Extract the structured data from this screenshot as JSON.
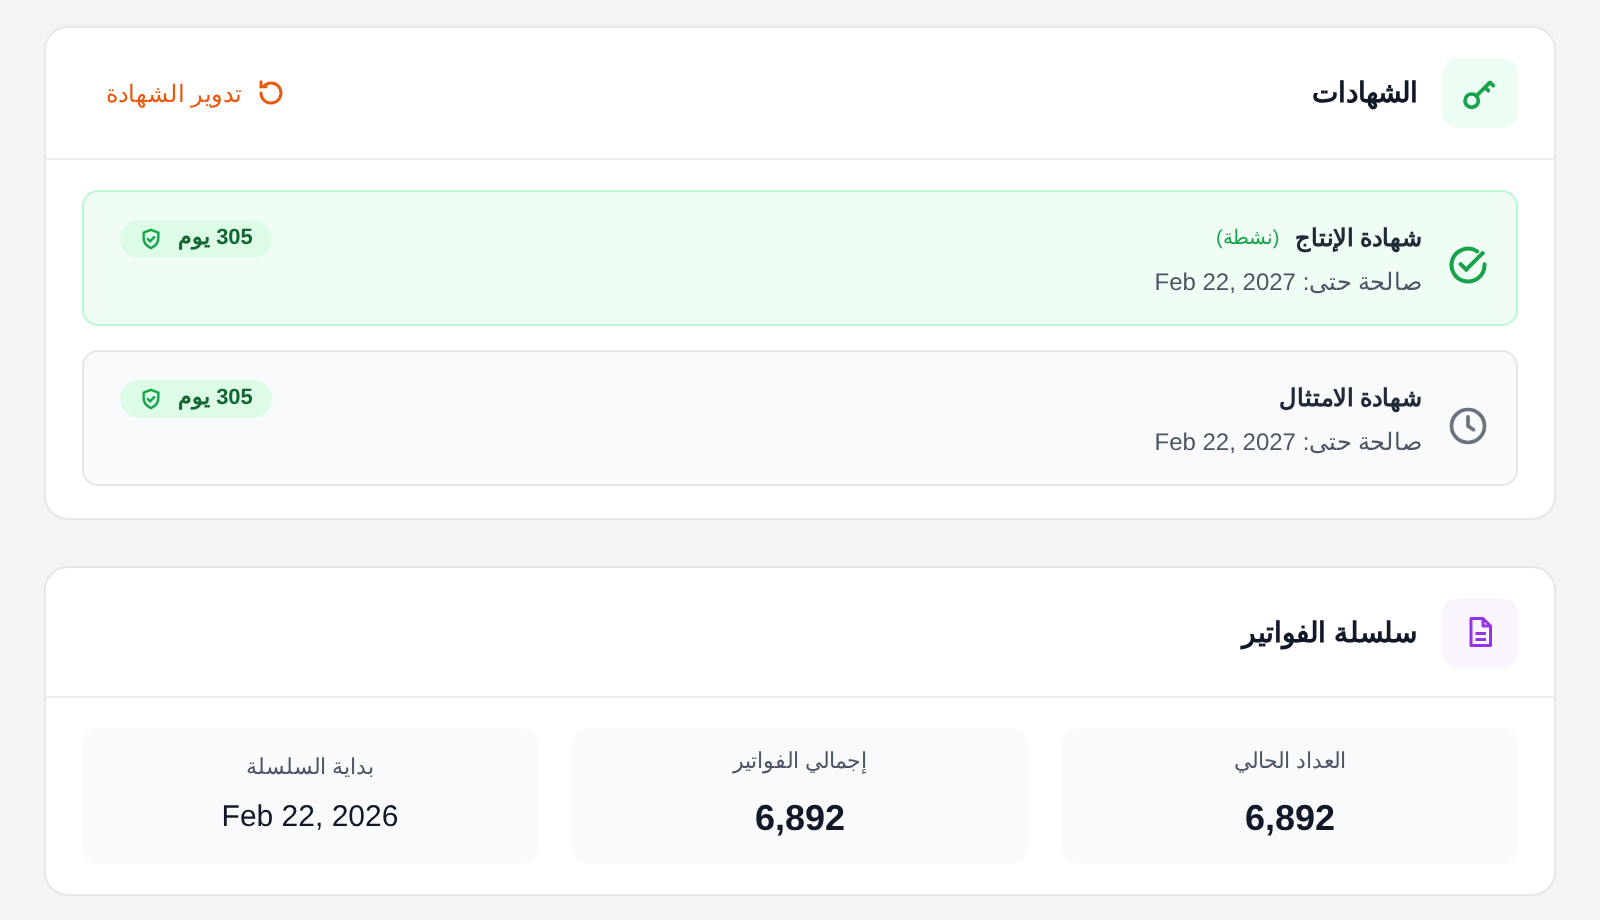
{
  "certificates": {
    "title": "الشهادات",
    "rotate_button": "تدوير الشهادة",
    "items": [
      {
        "name": "شهادة الإنتاج",
        "status": "(نشطة)",
        "active": true,
        "valid_until": "صالحة حتى: Feb 22, 2027",
        "days": "305 يوم"
      },
      {
        "name": "شهادة الامتثال",
        "active": false,
        "valid_until": "صالحة حتى: Feb 22, 2027",
        "days": "305 يوم"
      }
    ]
  },
  "invoice_series": {
    "title": "سلسلة الفواتير",
    "stats": [
      {
        "label": "العداد الحالي",
        "value": "6,892",
        "kind": "number"
      },
      {
        "label": "إجمالي الفواتير",
        "value": "6,892",
        "kind": "number"
      },
      {
        "label": "بداية السلسلة",
        "value": "Feb 22, 2026",
        "kind": "date"
      }
    ]
  }
}
